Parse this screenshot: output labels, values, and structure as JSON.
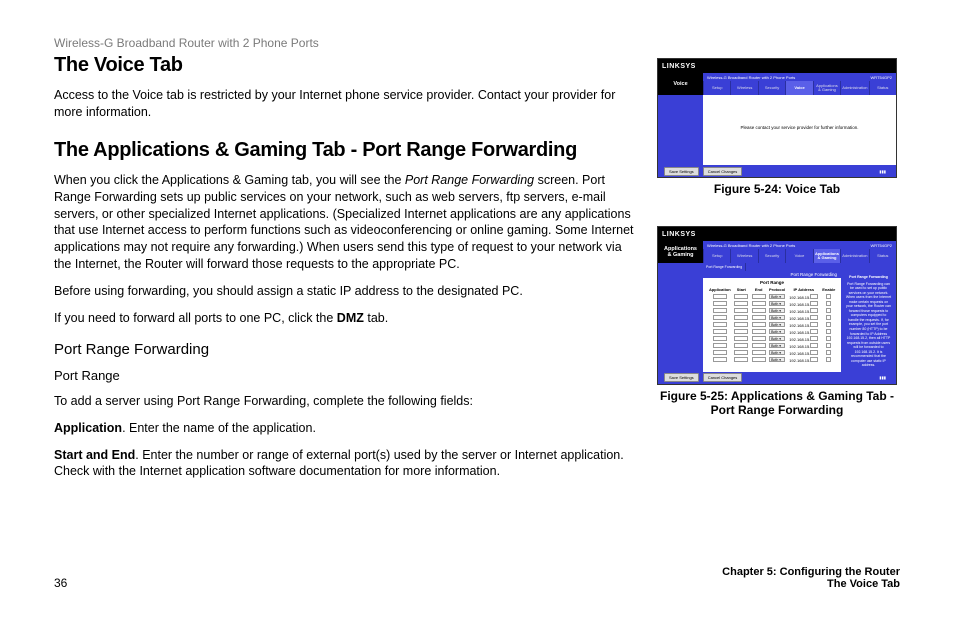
{
  "header": "Wireless-G Broadband Router with 2 Phone Ports",
  "h1_voice": "The Voice Tab",
  "p_voice": "Access to the Voice tab is restricted by your Internet phone service provider. Contact your provider for more information.",
  "h1_apps": "The Applications & Gaming Tab - Port Range Forwarding",
  "p_apps_1a": "When you click the Applications & Gaming tab, you will see the ",
  "p_apps_1b_italic": "Port Range Forwarding",
  "p_apps_1c": " screen. Port Range Forwarding sets up public services on your network, such as web servers, ftp servers, e-mail servers, or other specialized Internet applications. (Specialized Internet applications are any applications that use Internet access to perform functions such as videoconferencing or online gaming. Some Internet applications may not require any forwarding.) When users send this type of request to your network via the Internet, the Router will forward those requests to the appropriate PC.",
  "p_apps_2": "Before using forwarding, you should assign a static IP address to the designated PC.",
  "p_apps_3a": "If you need to forward all ports to one PC, click the ",
  "p_apps_3b_bold": "DMZ",
  "p_apps_3c": " tab.",
  "h2_prf": "Port Range Forwarding",
  "h3_pr": "Port Range",
  "p_add": "To add a server using Port Range Forwarding, complete the following fields:",
  "p_app_a": "Application",
  "p_app_b": ". Enter the name of the application.",
  "p_se_a": "Start and End",
  "p_se_b": ". Enter the number or range of external port(s) used by the server or Internet application. Check with the Internet application software documentation for more information.",
  "page_number": "36",
  "chapter_line1": "Chapter 5: Configuring the Router",
  "chapter_line2": "The Voice Tab",
  "fig1_caption": "Figure 5-24: Voice Tab",
  "fig2_caption": "Figure 5-25: Applications & Gaming Tab - Port Range Forwarding",
  "router": {
    "logo": "LINKSYS",
    "product": "Wireless-G Broadband Router with 2 Phone Ports",
    "model": "WRT54GP2",
    "tabs": [
      "Setup",
      "Wireless",
      "Security",
      "Voice",
      "Applications & Gaming",
      "Administration",
      "Status"
    ],
    "voice_label": "Voice",
    "apps_label": "Applications\n& Gaming",
    "voice_message": "Please contact your service provider for further information.",
    "save_btn": "Save Settings",
    "cancel_btn": "Cancel Changes",
    "sec_tabs": [
      "Port Range Forwarding"
    ],
    "panel_title": "Port Range Forwarding",
    "section_head": "Port Range",
    "cols": [
      "Application",
      "Start",
      "End",
      "Protocol",
      "IP Address",
      "Enable"
    ],
    "ip_prefix": "192.168.15.",
    "protocol_default": "Both",
    "row_count": 10,
    "help_heading": "Port Range Forwarding",
    "help_text": "Port Range Forwarding can be used to set up public services on your network. When users from the Internet make certain requests on your network, the Router can forward those requests to computers equipped to handle the requests. If, for example, you set the port number 80 (HTTP) to be forwarded to IP Address 192.168.15.2, then all HTTP requests from outside users will be forwarded to 192.168.15.2. It is recommended that the computer use static IP address."
  }
}
